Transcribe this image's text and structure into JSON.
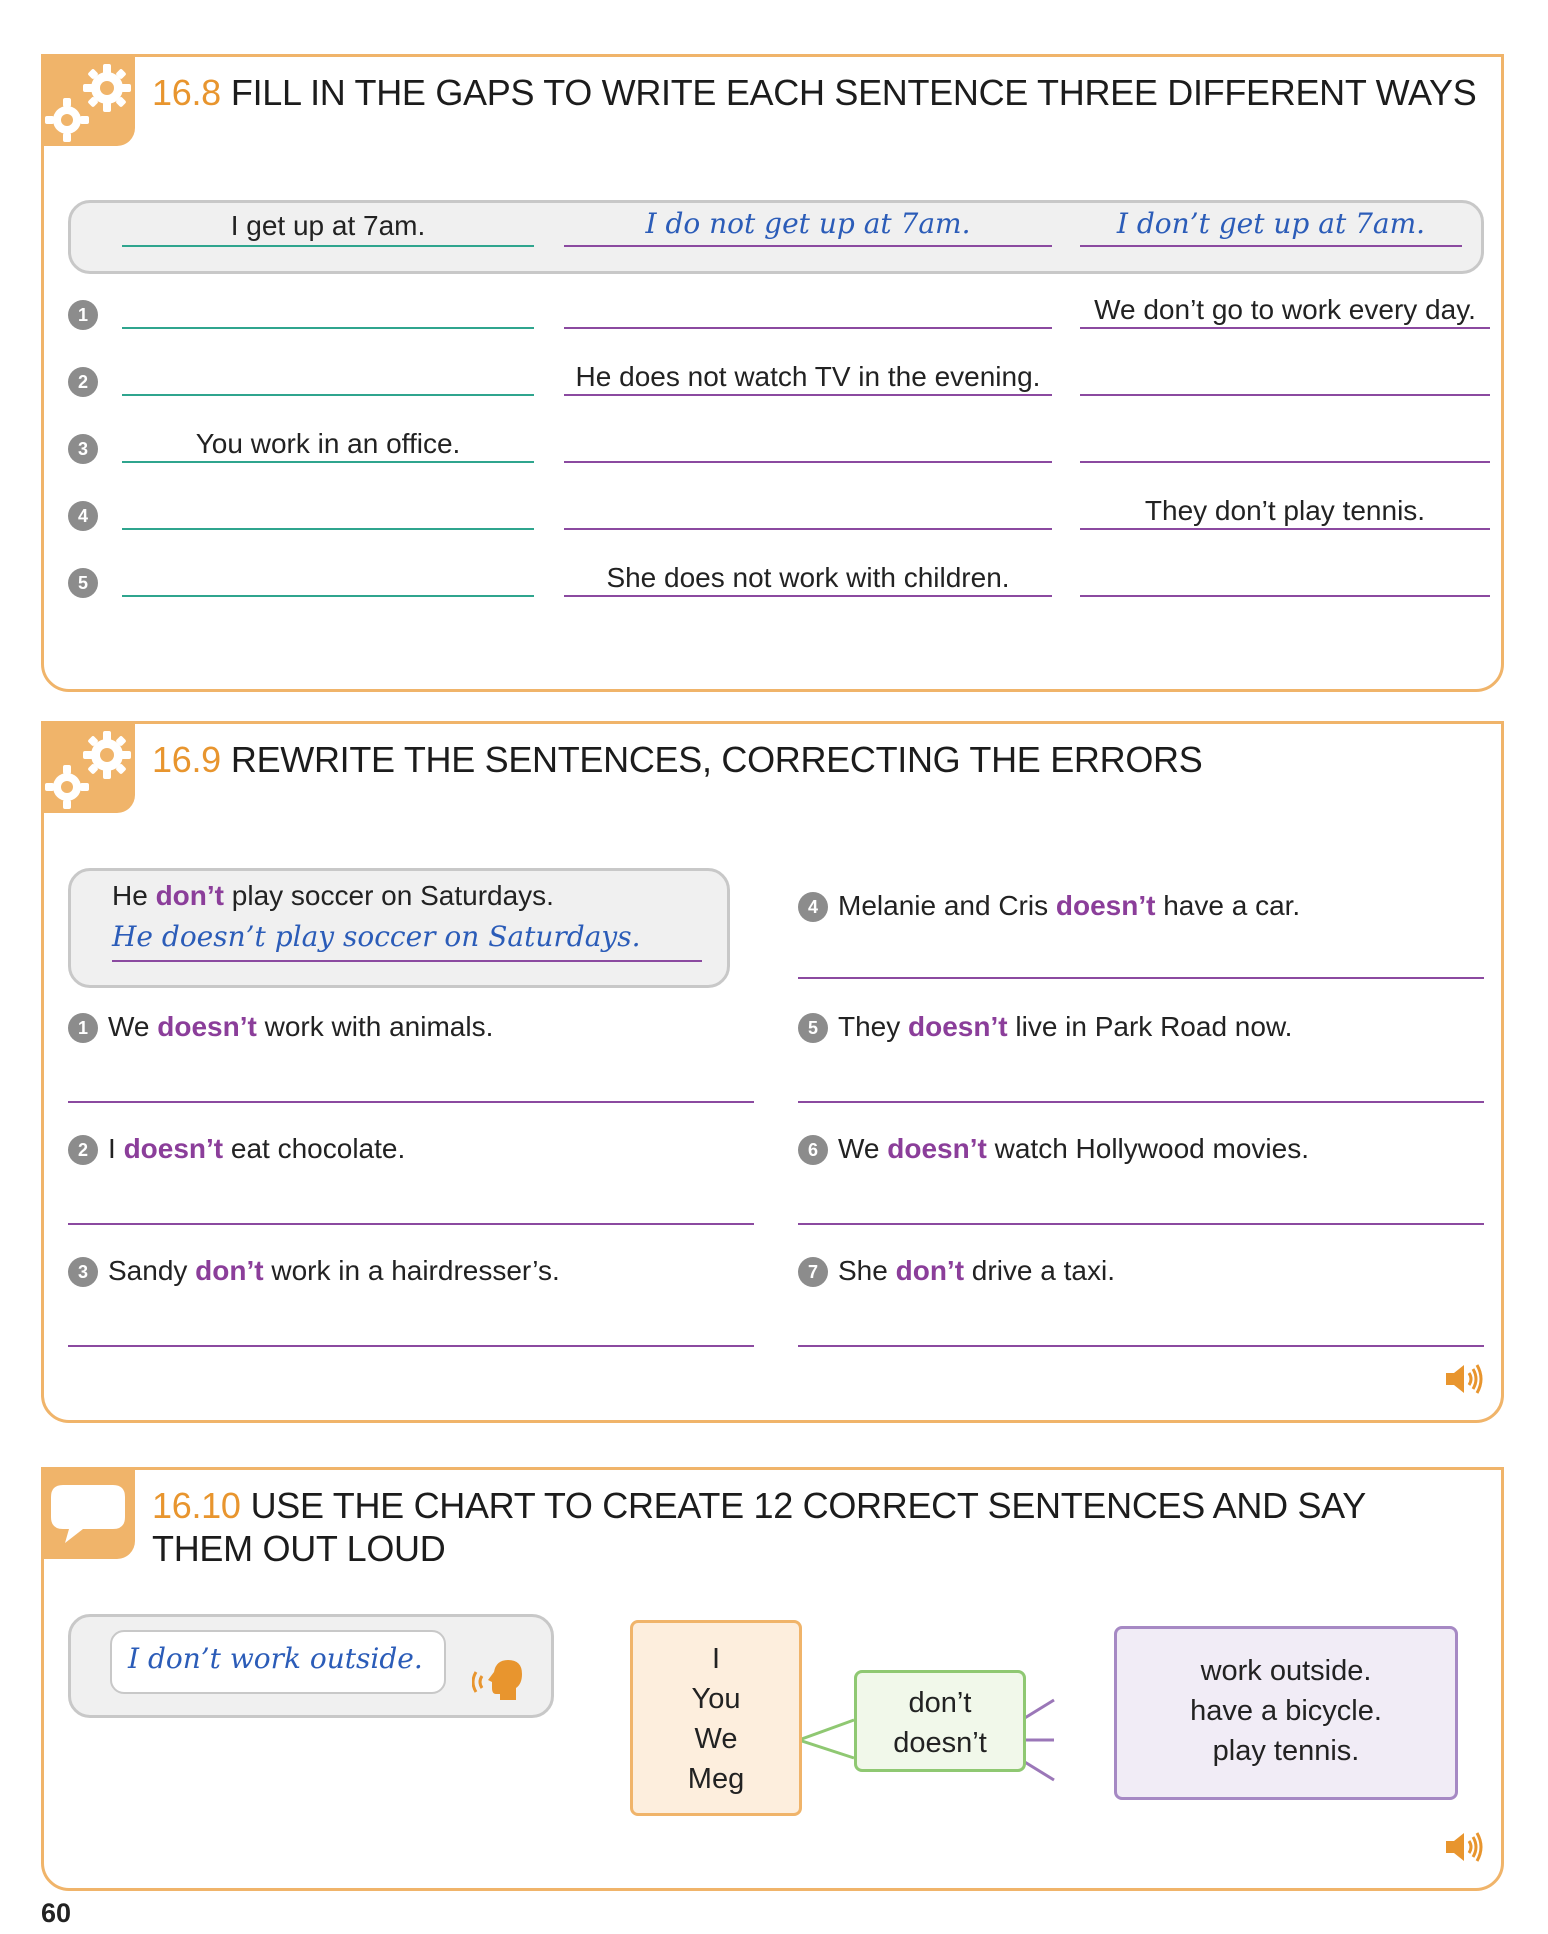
{
  "ex168": {
    "number": "16.8",
    "title": "FILL IN THE GAPS TO WRITE EACH SENTENCE THREE DIFFERENT WAYS",
    "example": {
      "col1": "I get up at 7am.",
      "col2": "I do not get up at 7am.",
      "col3": "I don’t get up at 7am."
    },
    "rows": [
      {
        "n": "1",
        "col1": "",
        "col2": "",
        "col3": "We don’t go to work every day."
      },
      {
        "n": "2",
        "col1": "",
        "col2": "He does not watch TV in the evening.",
        "col3": ""
      },
      {
        "n": "3",
        "col1": "You work in an office.",
        "col2": "",
        "col3": ""
      },
      {
        "n": "4",
        "col1": "",
        "col2": "",
        "col3": "They don’t play tennis."
      },
      {
        "n": "5",
        "col1": "",
        "col2": "She does not work with children.",
        "col3": ""
      }
    ]
  },
  "ex169": {
    "number": "16.9",
    "title": "REWRITE THE SENTENCES, CORRECTING THE ERRORS",
    "example": {
      "pre": "He ",
      "err": "don’t",
      "post": " play soccer on Saturdays.",
      "answer": "He doesn’t play soccer on Saturdays."
    },
    "items": [
      {
        "n": "1",
        "pre": "We ",
        "err": "doesn’t",
        "post": " work with animals."
      },
      {
        "n": "2",
        "pre": "I ",
        "err": "doesn’t",
        "post": " eat chocolate."
      },
      {
        "n": "3",
        "pre": "Sandy ",
        "err": "don’t",
        "post": " work in a hairdresser’s."
      },
      {
        "n": "4",
        "pre": "Melanie and Cris ",
        "err": "doesn’t",
        "post": " have a car."
      },
      {
        "n": "5",
        "pre": "They ",
        "err": "doesn’t",
        "post": " live in Park Road now."
      },
      {
        "n": "6",
        "pre": "We ",
        "err": "doesn’t",
        "post": " watch Hollywood movies."
      },
      {
        "n": "7",
        "pre": "She ",
        "err": "don’t",
        "post": " drive a taxi."
      }
    ]
  },
  "ex1610": {
    "number": "16.10",
    "title_line1": "USE THE CHART TO CREATE 12 CORRECT SENTENCES AND SAY",
    "title_line2": "THEM OUT LOUD",
    "example": "I don’t work outside.",
    "subjects": [
      "I",
      "You",
      "We",
      "Meg"
    ],
    "verbs": [
      "don’t",
      "doesn’t"
    ],
    "endings": [
      "work outside.",
      "have a bicycle.",
      "play tennis."
    ]
  },
  "page_number": "60",
  "colors": {
    "accent": "#f0b46a",
    "heading_number": "#e8952e",
    "error": "#8b3e9a",
    "handwriting": "#2b5cb8",
    "line_purple": "#8b4aa0",
    "line_teal": "#2fa58e"
  },
  "icons": [
    "gears-icon",
    "speech-bubble-icon",
    "speaker-icon",
    "speaking-head-icon"
  ]
}
